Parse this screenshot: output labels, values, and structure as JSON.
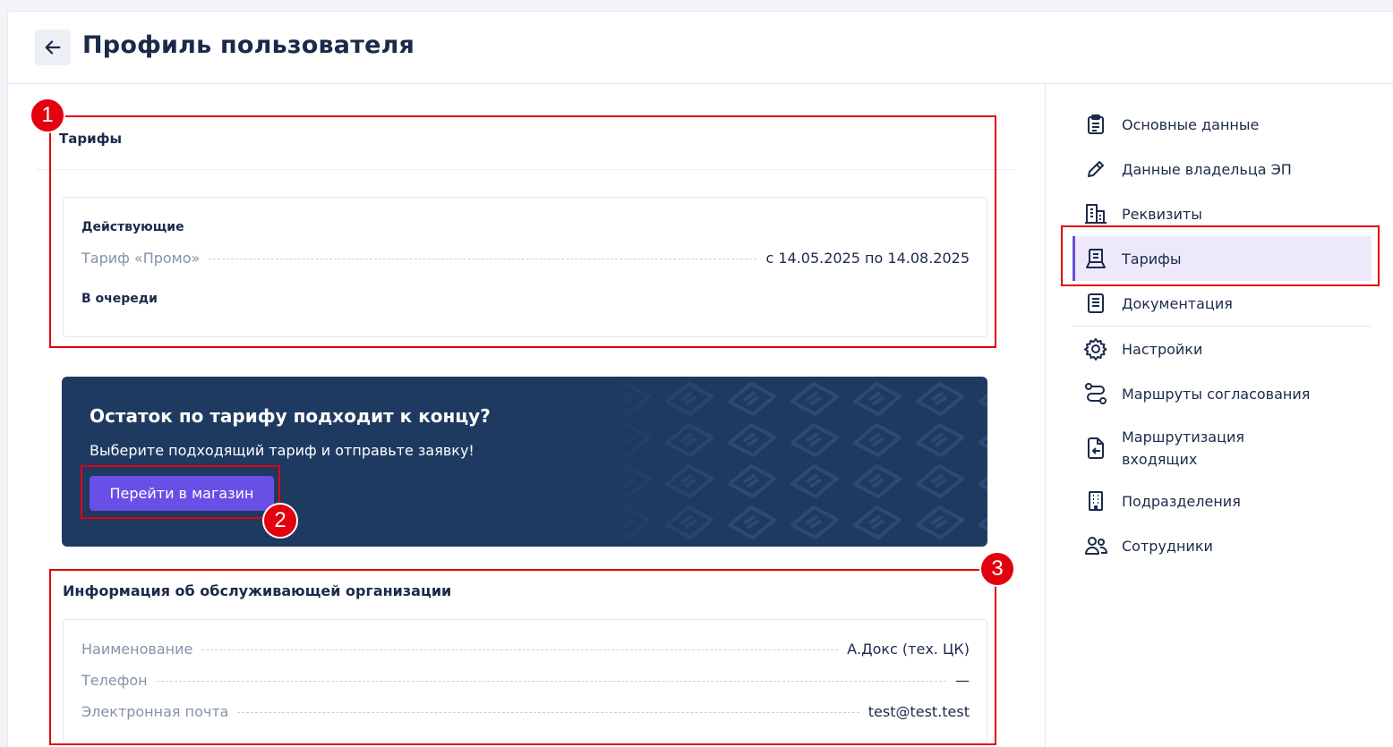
{
  "header": {
    "title": "Профиль пользователя"
  },
  "tariffs": {
    "title": "Тарифы",
    "active_label": "Действующие",
    "rows": [
      {
        "name": "Тариф «Промо»",
        "period": "с 14.05.2025 по 14.08.2025"
      }
    ],
    "queue_label": "В очереди"
  },
  "banner": {
    "title": "Остаток по тарифу подходит к концу?",
    "subtitle": "Выберите подходящий тариф и отправьте заявку!",
    "button_label": "Перейти в магазин"
  },
  "service_org": {
    "title": "Информация об обслуживающей организации",
    "rows": [
      {
        "key": "Наименование",
        "value": "А.Докс (тех. ЦК)"
      },
      {
        "key": "Телефон",
        "value": "—"
      },
      {
        "key": "Электронная почта",
        "value": "test@test.test"
      }
    ]
  },
  "sidebar": {
    "items": [
      {
        "label": "Основные данные",
        "icon": "clipboard-icon"
      },
      {
        "label": "Данные владельца ЭП",
        "icon": "pencil-icon"
      },
      {
        "label": "Реквизиты",
        "icon": "building-icon"
      },
      {
        "label": "Тарифы",
        "icon": "receipt-icon",
        "active": true
      },
      {
        "label": "Документация",
        "icon": "document-icon"
      },
      {
        "label": "Настройки",
        "icon": "gear-icon"
      },
      {
        "label": "Маршруты согласования",
        "icon": "route-icon"
      },
      {
        "label_line1": "Маршрутизация",
        "label_line2": "входящих",
        "icon": "incoming-route-icon"
      },
      {
        "label": "Подразделения",
        "icon": "office-icon"
      },
      {
        "label": "Сотрудники",
        "icon": "users-icon"
      }
    ]
  },
  "markers": [
    "1",
    "2",
    "3"
  ],
  "colors": {
    "accent": "#6a4fe6",
    "banner_bg": "#1f3a60",
    "highlight_red": "#e3000f",
    "active_nav_bg": "#ede9fb"
  }
}
